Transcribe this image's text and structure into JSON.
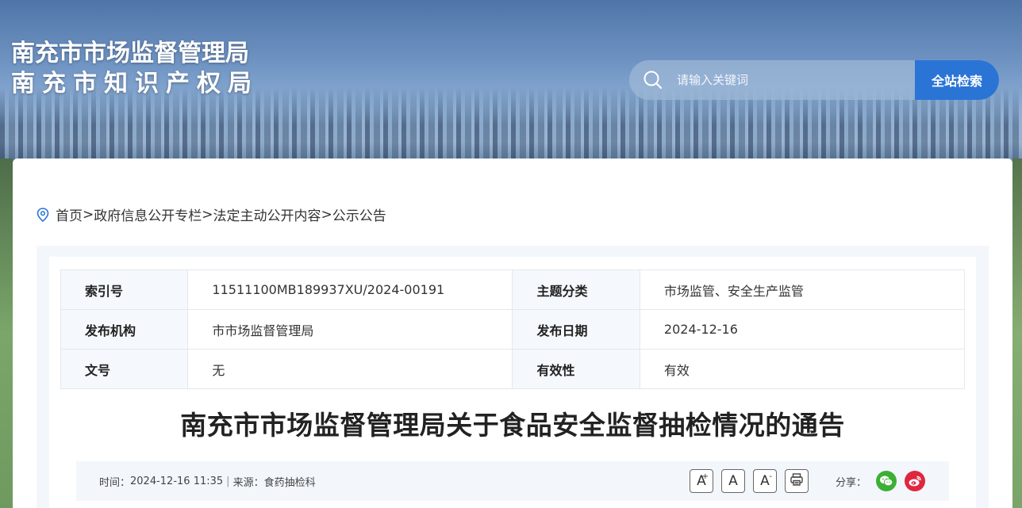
{
  "header": {
    "title_line1": "南充市市场监督管理局",
    "title_line2": "南充市知识产权局",
    "search": {
      "placeholder": "请输入关键词",
      "button_label": "全站检索"
    }
  },
  "breadcrumb": {
    "items": [
      "首页",
      "政府信息公开专栏",
      "法定主动公开内容",
      "公示公告"
    ],
    "separator": ">"
  },
  "meta_table": {
    "rows": [
      {
        "label1": "索引号",
        "value1": "11511100MB189937XU/2024-00191",
        "label2": "主题分类",
        "value2": "市场监管、安全生产监管"
      },
      {
        "label1": "发布机构",
        "value1": "市市场监督管理局",
        "label2": "发布日期",
        "value2": "2024-12-16"
      },
      {
        "label1": "文号",
        "value1": "无",
        "label2": "有效性",
        "value2": "有效"
      }
    ]
  },
  "article": {
    "title": "南充市市场监督管理局关于食品安全监督抽检情况的通告",
    "time_label": "时间：",
    "time_value": "2024-12-16 11:35",
    "divider": "|",
    "source_label": "来源：",
    "source_value": "食药抽检科",
    "tools": {
      "font_increase": "A",
      "font_increase_sup": "+",
      "font_reset": "A",
      "font_decrease": "A",
      "font_decrease_sup": "-"
    },
    "share_label": "分享："
  },
  "colors": {
    "accent": "#2a74d6",
    "wechat": "#3cb034",
    "weibo": "#e0263f"
  },
  "icons": [
    "search-icon",
    "location-pin-icon",
    "print-icon",
    "wechat-icon",
    "weibo-icon"
  ]
}
